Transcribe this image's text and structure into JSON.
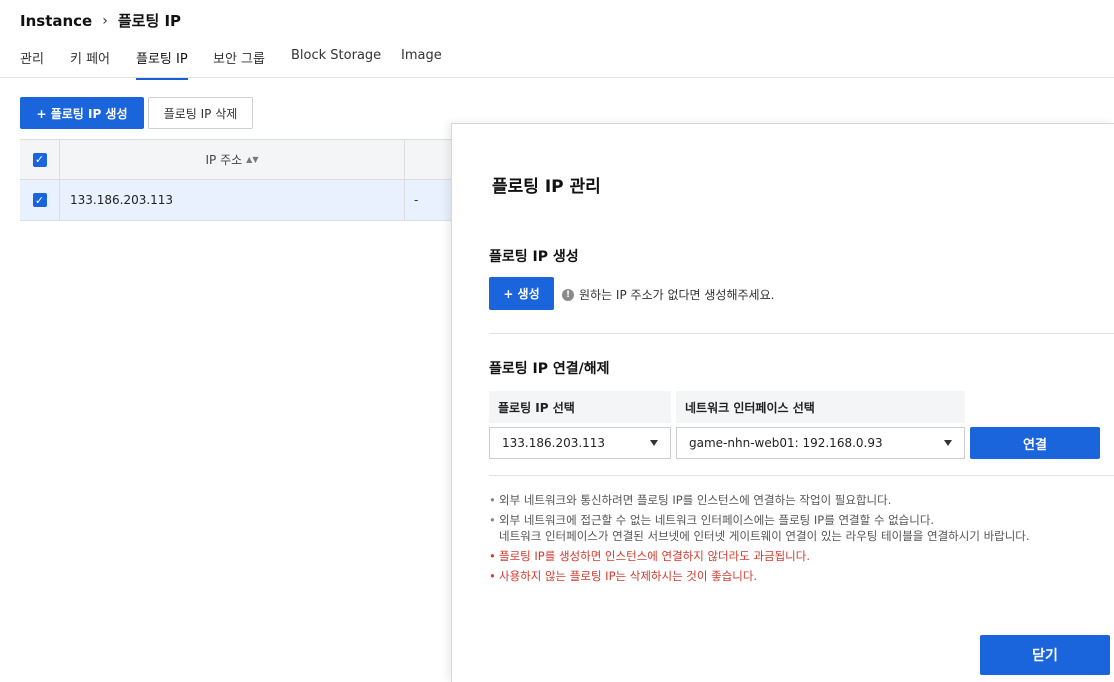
{
  "breadcrumb": {
    "root": "Instance",
    "separator": "›",
    "current": "플로팅 IP"
  },
  "tabs": [
    {
      "label": "관리"
    },
    {
      "label": "키 페어"
    },
    {
      "label": "플로팅 IP",
      "active": true
    },
    {
      "label": "보안 그룹"
    },
    {
      "label": "Block Storage"
    },
    {
      "label": "Image"
    }
  ],
  "toolbar": {
    "create_label": "+  플로팅 IP 생성",
    "delete_label": "플로팅 IP 삭제"
  },
  "grid": {
    "header": {
      "ip_label": "IP 주소",
      "sort_icon": "▲▼"
    },
    "rows": [
      {
        "ip": "133.186.203.113",
        "extra": "-",
        "checked": true
      }
    ]
  },
  "panel": {
    "title": "플로팅 IP 관리",
    "create_section": {
      "title": "플로팅 IP 생성",
      "button_label": "+  생성",
      "hint": "원하는 IP 주소가 없다면 생성해주세요.",
      "info_icon": "!"
    },
    "connect_section": {
      "title": "플로팅 IP 연결/해제",
      "col_ip_header": "플로팅 IP 선택",
      "col_nic_header": "네트워크 인터페이스 선택",
      "ip_select_value": "133.186.203.113",
      "nic_select_value": "game-nhn-web01: 192.168.0.93",
      "connect_button": "연결"
    },
    "notes": [
      {
        "text": "외부 네트워크와 통신하려면 플로팅 IP를 인스턴스에 연결하는 작업이 필요합니다.",
        "red": false
      },
      {
        "text": "외부 네트워크에 접근할 수 없는 네트워크 인터페이스에는 플로팅 IP를 연결할 수 없습니다.",
        "text2": "네트워크 인터페이스가 연결된 서브넷에 인터넷 게이트웨이 연결이 있는 라우팅 테이블을 연결하시기 바랍니다.",
        "red": false
      },
      {
        "text": "플로팅 IP를 생성하면 인스턴스에 연결하지 않더라도 과금됩니다.",
        "red": true
      },
      {
        "text": "사용하지 않는 플로팅 IP는 삭제하시는 것이 좋습니다.",
        "red": true
      }
    ],
    "close_button": "닫기"
  },
  "colors": {
    "primary": "#1a64dc",
    "selected_row": "#e8f1fd",
    "warning_text": "#d23b2f"
  }
}
